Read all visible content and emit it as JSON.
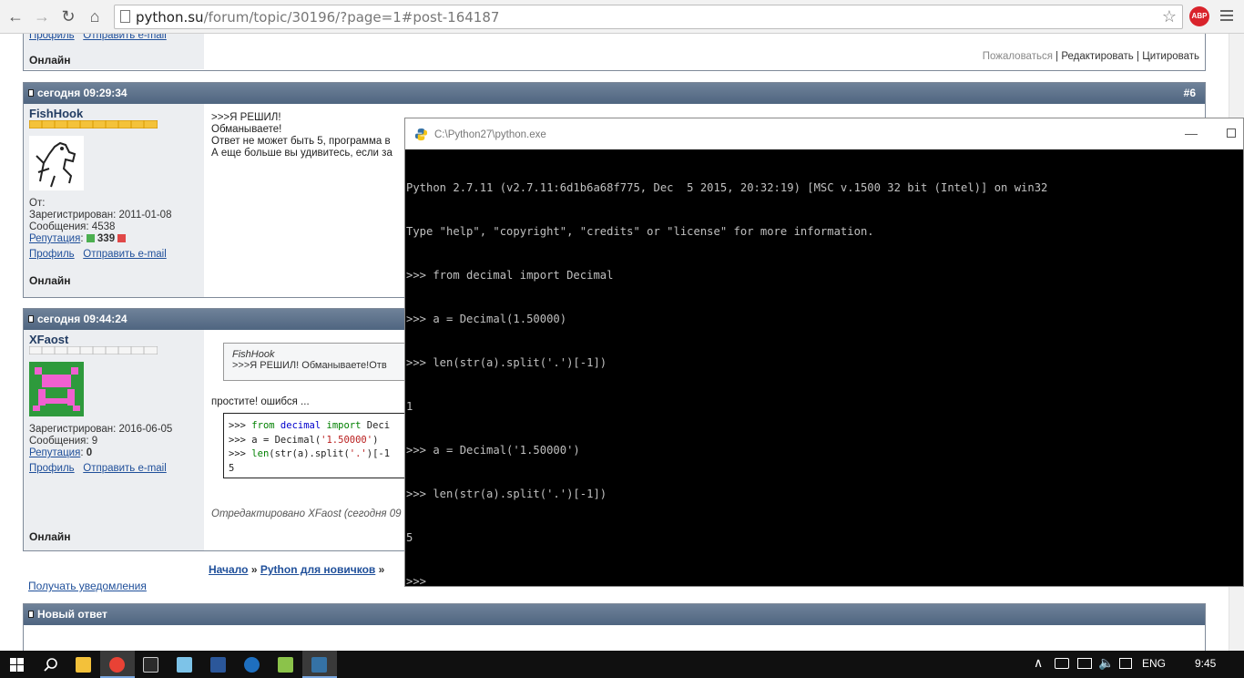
{
  "browser": {
    "url_host": "python.su",
    "url_path": "/forum/topic/30196/?page=1#post-164187",
    "abp_label": "ABP"
  },
  "top_post": {
    "links": {
      "profile": "Профиль",
      "send_email": "Отправить e-mail"
    },
    "status": "Онлайн",
    "actions": {
      "complain": "Пожаловаться",
      "edit": "Редактировать",
      "quote": "Цитировать",
      "sep": "|"
    }
  },
  "post6": {
    "date": "сегодня 09:29:34",
    "number": "#6",
    "user": "FishHook",
    "from_label": "От:",
    "registered": "Зарегистрирован: 2011-01-08",
    "messages": "Сообщения: 4538",
    "reputation_label": "Репутация",
    "reputation_value": "339",
    "profile": "Профиль",
    "send_email": "Отправить e-mail",
    "status": "Онлайн",
    "body": [
      ">>>Я РЕШИЛ!",
      "Обманываете!",
      "Ответ не может быть 5, программа в",
      "А еще больше вы удивитесь, если за"
    ]
  },
  "post7": {
    "date": "сегодня 09:44:24",
    "user": "XFaost",
    "registered": "Зарегистрирован: 2016-06-05",
    "messages": "Сообщения: 9",
    "reputation_label": "Репутация",
    "reputation_value": "0",
    "profile": "Профиль",
    "send_email": "Отправить e-mail",
    "status": "Онлайн",
    "quote_author": "FishHook",
    "quote_text": ">>>Я РЕШИЛ! Обманываете!Отв",
    "text": "простите! ошибся ...",
    "code": {
      "prompt": ">>> ",
      "l1_from": "from",
      "l1_mod": "decimal",
      "l1_import": "import",
      "l1_name": "Deci",
      "l2_pre": "a = Decimal(",
      "l2_str": "'1.50000'",
      "l2_post": ")",
      "l3_len": "len",
      "l3_mid": "(str(a).split(",
      "l3_str": "'.'",
      "l3_post": ")[-1",
      "l4": "5"
    },
    "edited": "Отредактировано XFaost (сегодня 09"
  },
  "breadcrumb": {
    "home": "Начало",
    "sep": "»",
    "forum": "Python для новичков",
    "sep2": "»"
  },
  "notify": "Получать уведомления",
  "new_reply": "Новый ответ",
  "console": {
    "title": "C:\\Python27\\python.exe",
    "lines": [
      "Python 2.7.11 (v2.7.11:6d1b6a68f775, Dec  5 2015, 20:32:19) [MSC v.1500 32 bit (Intel)] on win32",
      "Type \"help\", \"copyright\", \"credits\" or \"license\" for more information.",
      ">>> from decimal import Decimal",
      ">>> a = Decimal(1.50000)",
      ">>> len(str(a).split('.')[-1])",
      "1",
      ">>> a = Decimal('1.50000')",
      ">>> len(str(a).split('.')[-1])",
      "5",
      ">>>"
    ]
  },
  "taskbar": {
    "lang": "ENG",
    "time": "9:45",
    "colors": {
      "explorer": "#f3c13a",
      "chrome": "#e94235",
      "calc": "#2b2b2b",
      "notepad": "#7dc3e8",
      "word": "#2b579a",
      "media": "#1e6fbf",
      "notepadpp": "#8bc34a",
      "python": "#3572a5"
    }
  }
}
